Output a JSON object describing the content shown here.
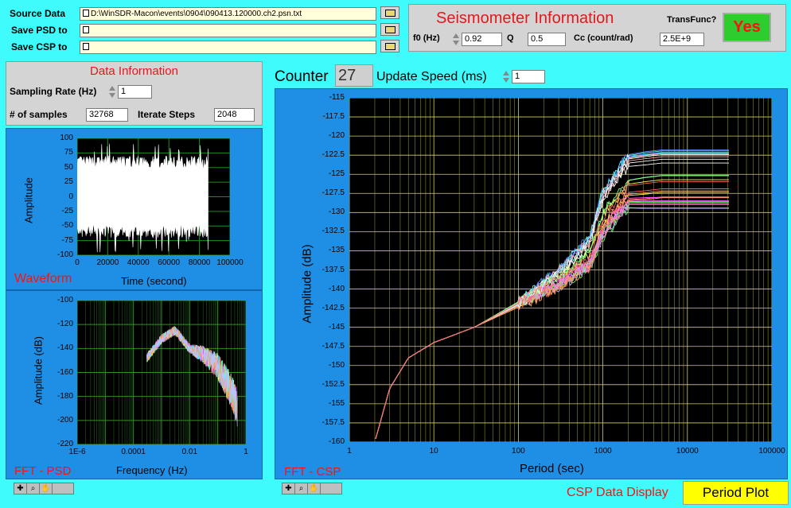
{
  "files": {
    "source_label": "Source Data",
    "source_path": "D:\\WinSDR-Macon\\events\\0904\\090413.120000.ch2.psn.txt",
    "psd_label": "Save PSD to",
    "psd_path": "",
    "csp_label": "Save CSP to",
    "csp_path": ""
  },
  "seismometer": {
    "title": "Seismometer Information",
    "transfunc_label": "TransFunc?",
    "transfunc_value": "Yes",
    "f0_label": "f0 (Hz)",
    "f0": "0.92",
    "q_label": "Q",
    "q": "0.5",
    "cc_label": "Cc (count/rad)",
    "cc": "2.5E+9"
  },
  "data_info": {
    "title": "Data Information",
    "rate_label": "Sampling Rate (Hz)",
    "rate": "1",
    "samples_label": "# of samples",
    "samples": "32768",
    "steps_label": "Iterate Steps",
    "steps": "2048"
  },
  "counter": {
    "label": "Counter",
    "value": "27",
    "speed_label": "Update Speed (ms)",
    "speed": "1"
  },
  "waveform": {
    "name": "Waveform",
    "ylabel": "Amplitude",
    "xlabel": "Time (second)",
    "yticks": [
      "100",
      "75",
      "50",
      "25",
      "0",
      "-25",
      "-50",
      "-75",
      "-100"
    ],
    "xticks": [
      "0",
      "20000",
      "40000",
      "60000",
      "80000",
      "100000"
    ]
  },
  "psd": {
    "name": "FFT - PSD",
    "ylabel": "Amplitude (dB)",
    "xlabel": "Frequency (Hz)",
    "yticks": [
      "-100",
      "-120",
      "-140",
      "-160",
      "-180",
      "-200",
      "-220"
    ],
    "xticks": [
      "1E-6",
      "0.0001",
      "0.01",
      "1"
    ]
  },
  "csp": {
    "name": "FFT - CSP",
    "ylabel": "Amplitude (dB)",
    "xlabel": "Period (sec)",
    "yticks": [
      "-115",
      "-117.5",
      "-120",
      "-122.5",
      "-125",
      "-127.5",
      "-130",
      "-132.5",
      "-135",
      "-137.5",
      "-140",
      "-142.5",
      "-145",
      "-147.5",
      "-150",
      "-152.5",
      "-155",
      "-157.5",
      "-160"
    ],
    "xticks": [
      "1",
      "10",
      "100",
      "1000",
      "10000",
      "100000"
    ]
  },
  "display": {
    "label": "CSP Data Display",
    "mode": "Period Plot"
  },
  "colors": {
    "bg": "#3ffbfb",
    "graph_frame": "#1f8fe5",
    "yes_button": "#2ecc2e",
    "yes_text": "#ff1010",
    "mode_button": "#ffff00"
  },
  "chart_data": [
    {
      "type": "line",
      "title": "",
      "xlabel": "Time (second)",
      "ylabel": "Amplitude",
      "xlim": [
        0,
        100000
      ],
      "ylim": [
        -100,
        100
      ],
      "grid": true,
      "series": [
        {
          "values_summary": "dense noise, mostly -75 to 75, ends near x=86000"
        }
      ]
    },
    {
      "type": "line",
      "title": "",
      "xlabel": "Frequency (Hz)",
      "ylabel": "Amplitude (dB)",
      "xscale": "log",
      "xlim": [
        1e-06,
        1
      ],
      "ylim": [
        -220,
        -100
      ],
      "grid": true,
      "series": [
        {
          "x": [
            0.0003,
            0.001,
            0.003,
            0.01,
            0.03,
            0.1,
            0.3,
            0.5
          ],
          "y": [
            -148,
            -132,
            -125,
            -140,
            -145,
            -155,
            -175,
            -190
          ]
        }
      ]
    },
    {
      "type": "line",
      "title": "",
      "xlabel": "Period (sec)",
      "ylabel": "Amplitude (dB)",
      "xscale": "log",
      "xlim": [
        1,
        100000
      ],
      "ylim": [
        -160,
        -115
      ],
      "grid": true,
      "series": [
        {
          "x": [
            2,
            3,
            5,
            10,
            30,
            100,
            300,
            700,
            1000,
            2000,
            5000,
            30000
          ],
          "y": [
            -160,
            -153,
            -149,
            -147,
            -145,
            -142,
            -138,
            -134,
            -128,
            -123.5,
            -123,
            -123
          ]
        },
        {
          "x": [
            2,
            3,
            5,
            10,
            30,
            100,
            300,
            700,
            1000,
            2000,
            5000,
            30000
          ],
          "y": [
            -160,
            -153,
            -149,
            -147,
            -145,
            -142,
            -139,
            -136,
            -131,
            -127,
            -126.5,
            -126.5
          ]
        },
        {
          "x": [
            2,
            3,
            5,
            10,
            30,
            100,
            300,
            700,
            1000,
            2000,
            5000,
            30000
          ],
          "y": [
            -160,
            -153,
            -149,
            -147,
            -145,
            -142,
            -139.5,
            -137,
            -133,
            -129,
            -129,
            -129
          ]
        }
      ]
    }
  ]
}
